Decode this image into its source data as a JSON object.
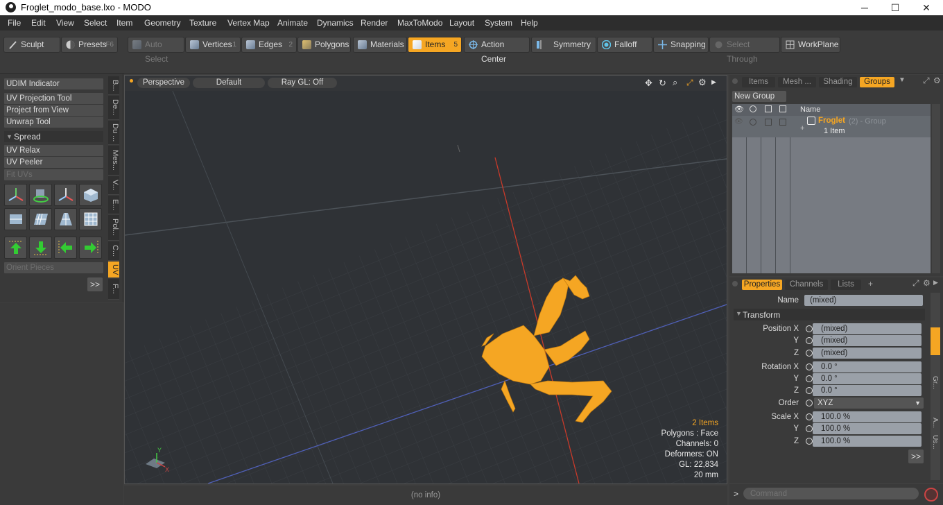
{
  "app": {
    "title": "Froglet_modo_base.lxo - MODO"
  },
  "window_buttons": {
    "minimize": "─",
    "maximize": "☐",
    "close": "✕"
  },
  "menu": [
    "File",
    "Edit",
    "View",
    "Select",
    "Item",
    "Geometry",
    "Texture",
    "Vertex Map",
    "Animate",
    "Dynamics",
    "Render",
    "MaxToModo",
    "Layout",
    "System",
    "Help"
  ],
  "toolbar": {
    "sculpt": "Sculpt",
    "presets": "Presets",
    "presets_key": "F6",
    "auto_select": "Auto Select",
    "vertices": "Vertices",
    "vertices_key": "1",
    "edges": "Edges",
    "edges_key": "2",
    "polygons": "Polygons",
    "materials": "Materials",
    "items": "Items",
    "items_key": "5",
    "action_center": "Action Center",
    "symmetry": "Symmetry",
    "falloff": "Falloff",
    "snapping": "Snapping",
    "select_through": "Select Through",
    "workplane": "WorkPlane"
  },
  "left_panel": {
    "udim": "UDIM Indicator",
    "uv_projection": "UV Projection Tool",
    "project_view": "Project from View",
    "unwrap": "Unwrap Tool",
    "spread": "Spread",
    "uv_relax": "UV Relax",
    "uv_peeler": "UV Peeler",
    "fit_uvs": "Fit UVs",
    "orient": "Orient Pieces",
    "more": ">>"
  },
  "vertical_tabs": [
    "B...",
    "De...",
    "Du ...",
    "Mes...",
    "V...",
    "E...",
    "Pol...",
    "C...",
    "UV",
    "F..."
  ],
  "viewport": {
    "view": "Perspective",
    "style": "Default",
    "raygl": "Ray GL: Off",
    "stats": {
      "items": "2 Items",
      "polygons": "Polygons : Face",
      "channels": "Channels: 0",
      "deformers": "Deformers: ON",
      "gl": "GL: 22,834",
      "scale": "20 mm"
    },
    "axis_y": "Y",
    "axis_x": "X"
  },
  "status": {
    "info": "(no info)"
  },
  "right_top": {
    "tabs": [
      "Items",
      "Mesh ...",
      "Shading",
      "Groups"
    ],
    "new_group": "New Group",
    "col_name": "Name",
    "group_name": "Froglet",
    "group_meta": "(2) - Group",
    "group_items": "1 Item"
  },
  "right_bottom": {
    "tabs": [
      "Properties",
      "Channels",
      "Lists",
      "+"
    ],
    "name_label": "Name",
    "name_value": "(mixed)",
    "transform": "Transform",
    "position_label": "Position X",
    "rotation_label": "Rotation X",
    "order_label": "Order",
    "scale_label": "Scale X",
    "y": "Y",
    "z": "Z",
    "pos_x": "(mixed)",
    "pos_y": "(mixed)",
    "pos_z": "(mixed)",
    "rot_x": "0.0 °",
    "rot_y": "0.0 °",
    "rot_z": "0.0 °",
    "order": "XYZ",
    "scale_x": "100.0 %",
    "scale_y": "100.0 %",
    "scale_z": "100.0 %",
    "more": ">>",
    "side_gr": "Gr...",
    "side_a": "A...",
    "side_us": "Us..."
  },
  "command": {
    "prompt": ">",
    "placeholder": "Command"
  },
  "colors": {
    "accent": "#f5a623",
    "mesh": "#f5a623",
    "viewport_bg": "#2f3236"
  }
}
